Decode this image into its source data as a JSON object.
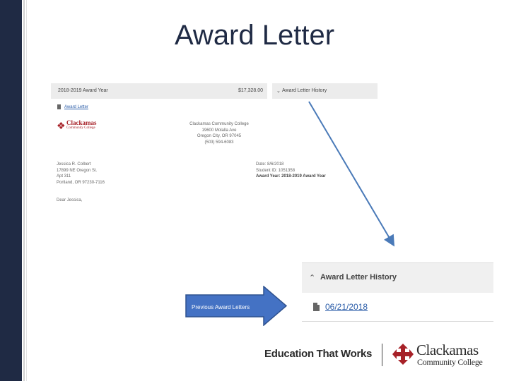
{
  "slide": {
    "title": "Award Letter"
  },
  "award_panel": {
    "year_label": "2018-2019 Award Year",
    "amount": "$17,328.00",
    "history_label_small": "Award Letter History",
    "doc_link": "Award Letter"
  },
  "letter": {
    "logo_name": "Clackamas",
    "logo_sub": "Community College",
    "college_address": [
      "Clackamas Community College",
      "19600 Molalla Ave",
      "Oregon City, OR 97045",
      "(503) 594-6083"
    ],
    "recipient": [
      "Jessica R. Colbert",
      "17899 NE Oregon St.",
      "Apt 311",
      "Portland, OR 97230-7116"
    ],
    "date_line": "Date: 8/6/2018",
    "student_id_line": "Student ID: 1051358",
    "award_year_line": "Award Year: 2018-2019 Award Year",
    "greeting": "Dear Jessica,"
  },
  "history_panel": {
    "label": "Award Letter History",
    "entries": [
      {
        "date": "06/21/2018"
      }
    ]
  },
  "callout": {
    "text": "Previous Award Letters"
  },
  "footer": {
    "tagline": "Education That Works",
    "logo_name": "Clackamas",
    "logo_sub": "Community College"
  },
  "colors": {
    "sidebar": "#1f2a44",
    "title": "#1f2a44",
    "callout_fill": "#4472c4",
    "callout_border": "#2f528f",
    "link": "#2a5ca8",
    "logo_red": "#a72128"
  },
  "icons": {
    "chevron": "chevron-up-icon",
    "document": "document-icon",
    "logo_mark": "clackamas-logo-mark"
  }
}
